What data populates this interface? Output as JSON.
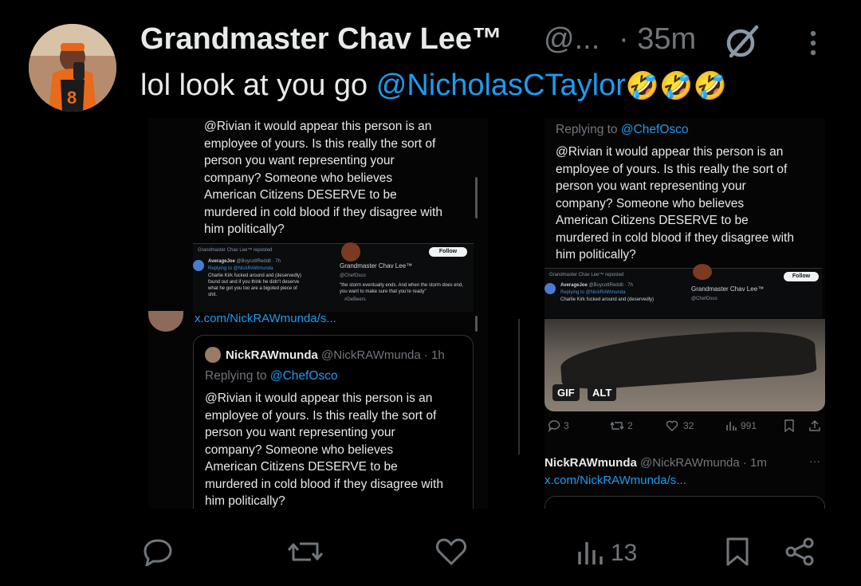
{
  "header": {
    "name": "Grandmaster Chav Lee™",
    "handle": "@...",
    "time": "· 35m"
  },
  "post": {
    "text_prefix": "lol look at you go ",
    "mention": "@NicholasCTaylor",
    "emoji": "🤣🤣🤣"
  },
  "left_shot": {
    "tweet_lines": [
      "@Rivian it would appear this person is an",
      "employee of yours. Is this really the sort of",
      "person you want representing your",
      "company? Someone who believes",
      "American Citizens DESERVE to be",
      "murdered in cold blood if they disagree with",
      "him politically?"
    ],
    "repost_label": "Grandmaster Chav Lee™ reposted",
    "quoted_name": "AverageJoe",
    "quoted_handle": "@BoycottReddit · 7h",
    "quoted_reply": "Replying to @NickRAWmunda",
    "quoted_lines": [
      "Charlie Kirk fucked around and (deservedly)",
      "found out and if you think he didn't deserve",
      "what he got you too are a bigoted piece of",
      "shit."
    ],
    "profile_name": "Grandmaster Chav Lee™",
    "profile_handle": "@ChefOsco",
    "profile_bio": "\"the storm eventually ends. And when the storm does end, you want to make sure that you're ready\"",
    "profile_tag": "#DeBeers",
    "follow_label": "Follow",
    "link_text": "x.com/NickRAWmunda/s...",
    "card_name": "NickRAWmunda",
    "card_handle": "@NickRAWmunda · 1h",
    "card_reply_prefix": "Replying to ",
    "card_reply_mention": "@ChefOsco"
  },
  "right_shot": {
    "reply_prefix": "Replying to ",
    "reply_mention": "@ChefOsco",
    "tweet_lines": [
      "@Rivian it would appear this person is an",
      "employee of yours. Is this really the sort of",
      "person you want representing your",
      "company? Someone who believes",
      "American Citizens DESERVE to be",
      "murdered in cold blood if they disagree with",
      "him politically?"
    ],
    "repost_label": "Grandmaster Chav Lee™ reposted",
    "quoted_name": "AverageJoe",
    "quoted_handle": "@BoycottReddit · 7h",
    "quoted_reply": "Replying to @NickRAWmunda",
    "quoted_line": "Charlie Kirk fucked around and (deservedly)",
    "profile_name": "Grandmaster Chav Lee™",
    "profile_handle": "@ChefOsco",
    "follow_label": "Follow",
    "gif_badge": "GIF",
    "alt_badge": "ALT",
    "stats": {
      "replies": "3",
      "reposts": "2",
      "likes": "32",
      "views": "991"
    },
    "reply_name": "NickRAWmunda",
    "reply_handle": "@NickRAWmunda · 1m",
    "reply_link": "x.com/NickRAWmunda/s...",
    "reply_more": "···"
  },
  "actions": {
    "views": "13"
  },
  "colors": {
    "accent": "#1d9bf0",
    "muted": "#71767b",
    "text": "#e7e9ea",
    "background": "#000000"
  },
  "icons": [
    "grok-icon",
    "more-icon",
    "reply-icon",
    "repost-icon",
    "like-icon",
    "views-icon",
    "bookmark-icon",
    "share-icon"
  ]
}
